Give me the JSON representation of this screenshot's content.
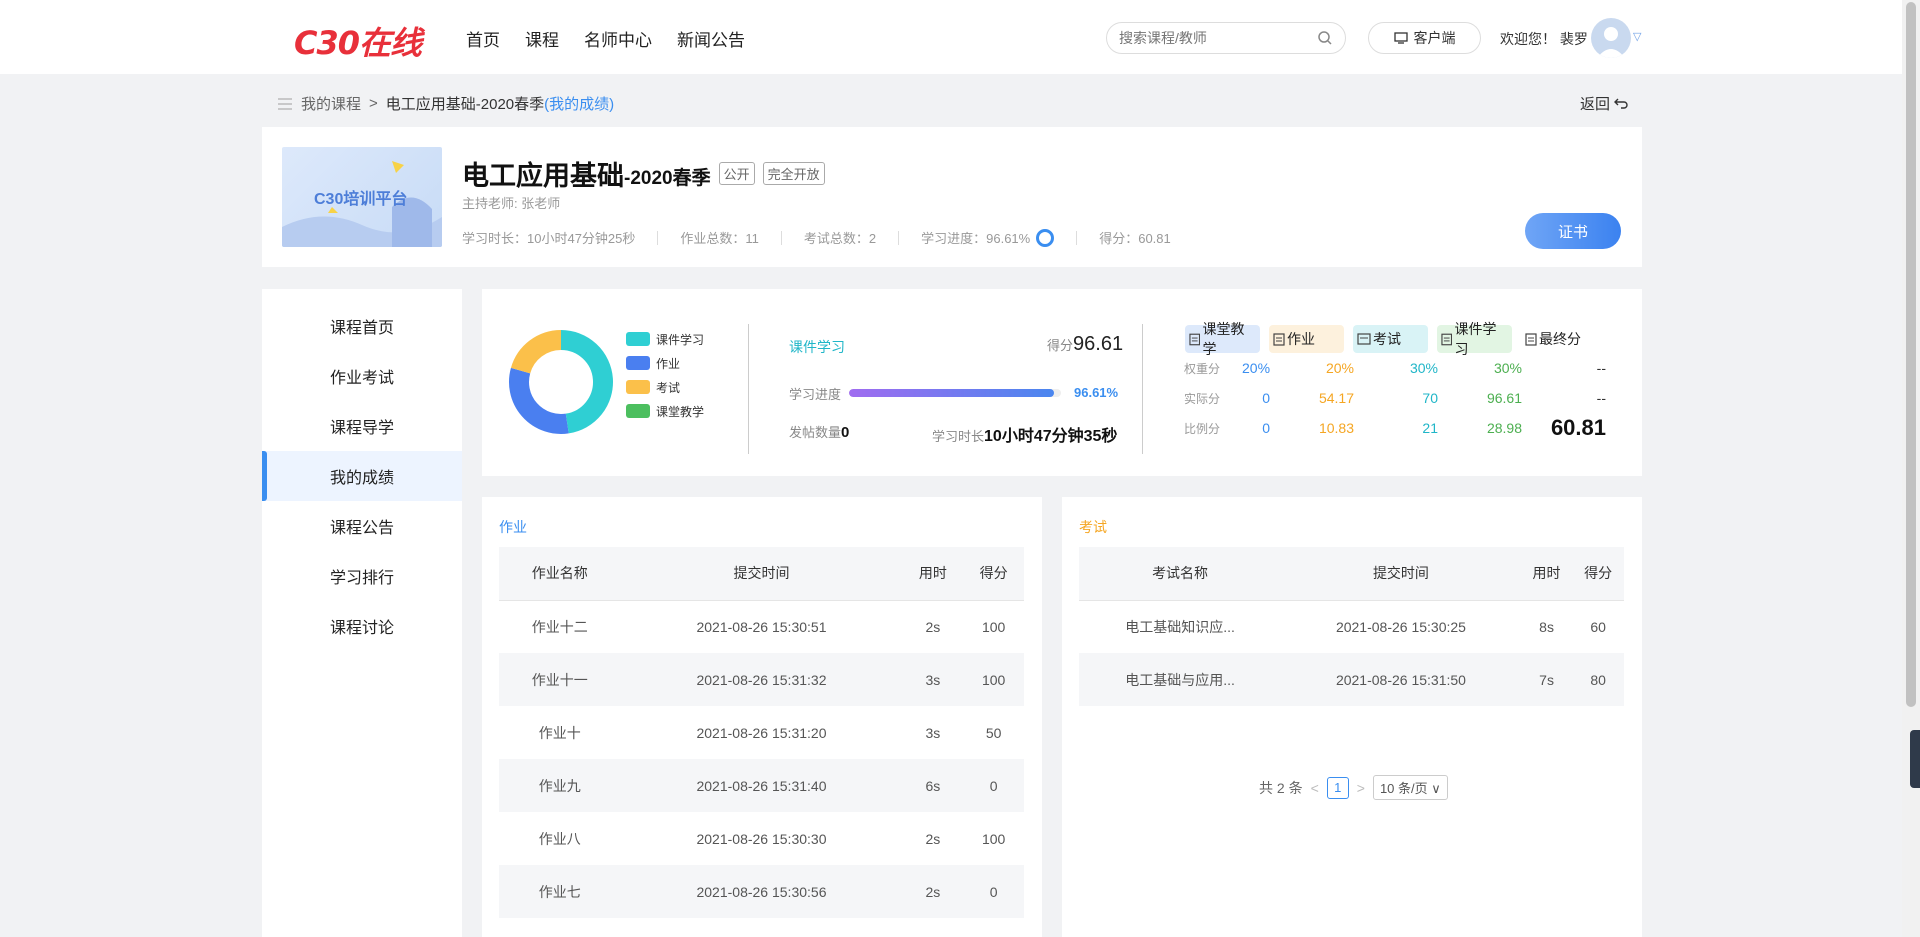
{
  "header": {
    "logo": "C30在线",
    "nav": [
      "首页",
      "课程",
      "名师中心",
      "新闻公告"
    ],
    "search_placeholder": "搜索课程/教师",
    "client_label": "客户端",
    "welcome": "欢迎您！ 裴罗"
  },
  "breadcrumb": {
    "root": "我的课程",
    "sep": ">",
    "current": "电工应用基础-2020春季",
    "highlight": "(我的成绩)",
    "back": "返回"
  },
  "course": {
    "thumb_text": "C30培训平台",
    "title": "电工应用基础",
    "subtitle": "-2020春季",
    "tags": [
      "公开",
      "完全开放"
    ],
    "teacher": "主持老师: 张老师",
    "stats": {
      "time": "学习时长：10小时47分钟25秒",
      "homework": "作业总数：11",
      "exams": "考试总数：2",
      "progress": "学习进度：96.61%",
      "score": "得分：60.81"
    },
    "cert_label": "证书"
  },
  "side_menu": {
    "items": [
      "课程首页",
      "作业考试",
      "课程导学",
      "我的成绩",
      "课程公告",
      "学习排行",
      "课程讨论"
    ],
    "active_index": 3
  },
  "summary": {
    "legend": [
      {
        "label": "课件学习",
        "color": "#2fcfd3"
      },
      {
        "label": "作业",
        "color": "#4a7ff0"
      },
      {
        "label": "考试",
        "color": "#fbc04a"
      },
      {
        "label": "课堂教学",
        "color": "#4cbf5f"
      }
    ],
    "donut_shares": [
      0.4762,
      0.3175,
      0.2063,
      0.0
    ],
    "courseware_title": "课件学习",
    "score_label": "得分",
    "score_value": "96.61",
    "progress_label": "学习进度",
    "progress_pct": "96.61%",
    "progress_value": 0.9661,
    "posts_label": "发帖数量",
    "posts_value": "0",
    "time_label": "学习时长",
    "time_value": "10小时47分钟35秒",
    "grid": {
      "headers": [
        "课堂教学",
        "作业",
        "考试",
        "课件学习",
        "最终分"
      ],
      "header_colors": [
        "#dde9fb",
        "#fdf1dd",
        "#d9f3f6",
        "#e2f5e3",
        "#ffffff"
      ],
      "rows": [
        {
          "label": "权重分",
          "values": [
            "20%",
            "20%",
            "30%",
            "30%",
            "--"
          ]
        },
        {
          "label": "实际分",
          "values": [
            "0",
            "54.17",
            "70",
            "96.61",
            "--"
          ]
        },
        {
          "label": "比例分",
          "values": [
            "0",
            "10.83",
            "21",
            "28.98",
            "60.81"
          ]
        }
      ]
    }
  },
  "homework": {
    "title": "作业",
    "columns": [
      "作业名称",
      "提交时间",
      "用时",
      "得分"
    ],
    "rows": [
      [
        "作业十二",
        "2021-08-26 15:30:51",
        "2s",
        "100"
      ],
      [
        "作业十一",
        "2021-08-26 15:31:32",
        "3s",
        "100"
      ],
      [
        "作业十",
        "2021-08-26 15:31:20",
        "3s",
        "50"
      ],
      [
        "作业九",
        "2021-08-26 15:31:40",
        "6s",
        "0"
      ],
      [
        "作业八",
        "2021-08-26 15:30:30",
        "2s",
        "100"
      ],
      [
        "作业七",
        "2021-08-26 15:30:56",
        "2s",
        "0"
      ]
    ]
  },
  "exam": {
    "title": "考试",
    "columns": [
      "考试名称",
      "提交时间",
      "用时",
      "得分"
    ],
    "rows": [
      [
        "电工基础知识应...",
        "2021-08-26 15:30:25",
        "8s",
        "60"
      ],
      [
        "电工基础与应用...",
        "2021-08-26 15:31:50",
        "7s",
        "80"
      ]
    ],
    "pager": {
      "total": "共 2 条",
      "page": "1",
      "size": "10 条/页"
    }
  }
}
